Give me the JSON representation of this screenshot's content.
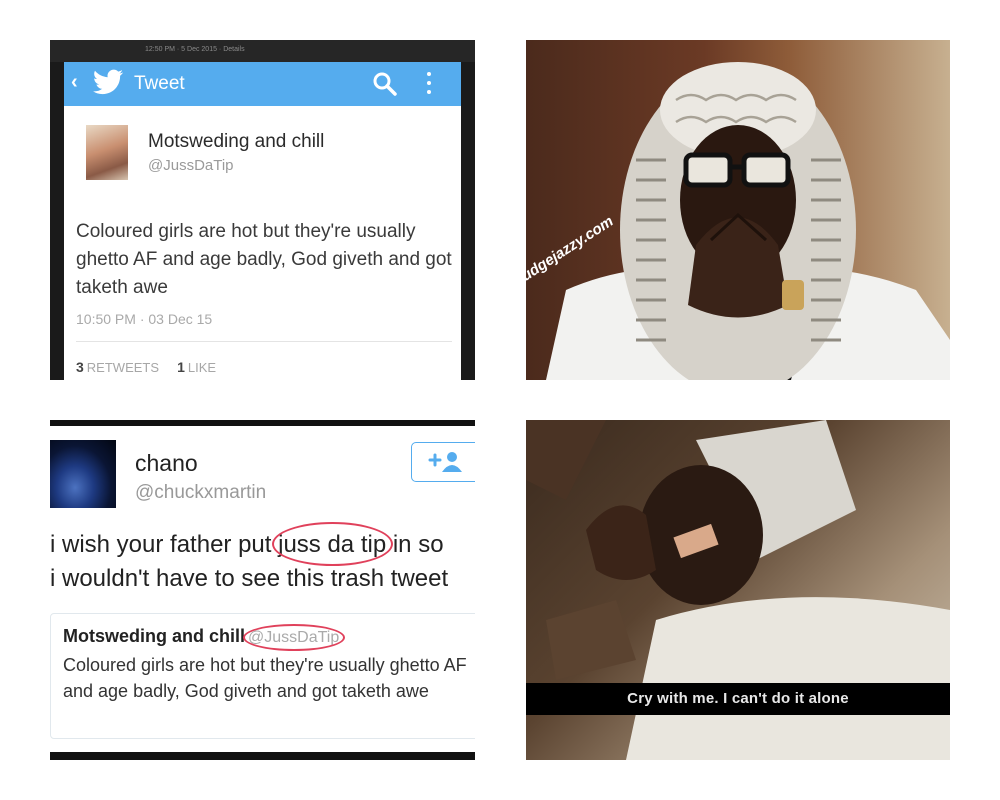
{
  "panel_tweet": {
    "status_bar_text": "12:50 PM · 5 Dec 2015 · Details",
    "app_title": "Tweet",
    "back_label": "‹",
    "display_name": "Motsweding and chill",
    "handle": "@JussDaTip",
    "text": "Coloured girls are hot but they're usually ghetto AF and age badly, God giveth and got taketh awe",
    "timestamp": "10:50 PM · 03 Dec 15",
    "retweets_count": "3",
    "retweets_label": "RETWEETS",
    "likes_count": "1",
    "likes_label": "LIKE",
    "colors": {
      "appbar": "#55acee"
    },
    "icons": [
      "twitter-bird-icon",
      "search-icon",
      "more-vert-icon"
    ]
  },
  "panel_judge": {
    "watermark": "judgejazzy.com"
  },
  "panel_reply": {
    "display_name": "chano",
    "handle": "@chuckxmartin",
    "reply_before": "i wish your father put",
    "reply_highlight": "juss da tip",
    "reply_after_line1": "in so",
    "reply_line2": "i wouldn't have to see this trash tweet",
    "quoted": {
      "display_name": "Motsweding and chill",
      "handle": "@JussDaTip",
      "text": "Coloured girls are hot but they're usually ghetto AF and age badly, God giveth and got taketh awe"
    },
    "colors": {
      "highlight_circle": "#e0415b",
      "follow_button": "#55acee"
    },
    "icons": [
      "follow-user-icon"
    ]
  },
  "panel_cry": {
    "subtitle": "Cry with me. I can't do it alone"
  }
}
